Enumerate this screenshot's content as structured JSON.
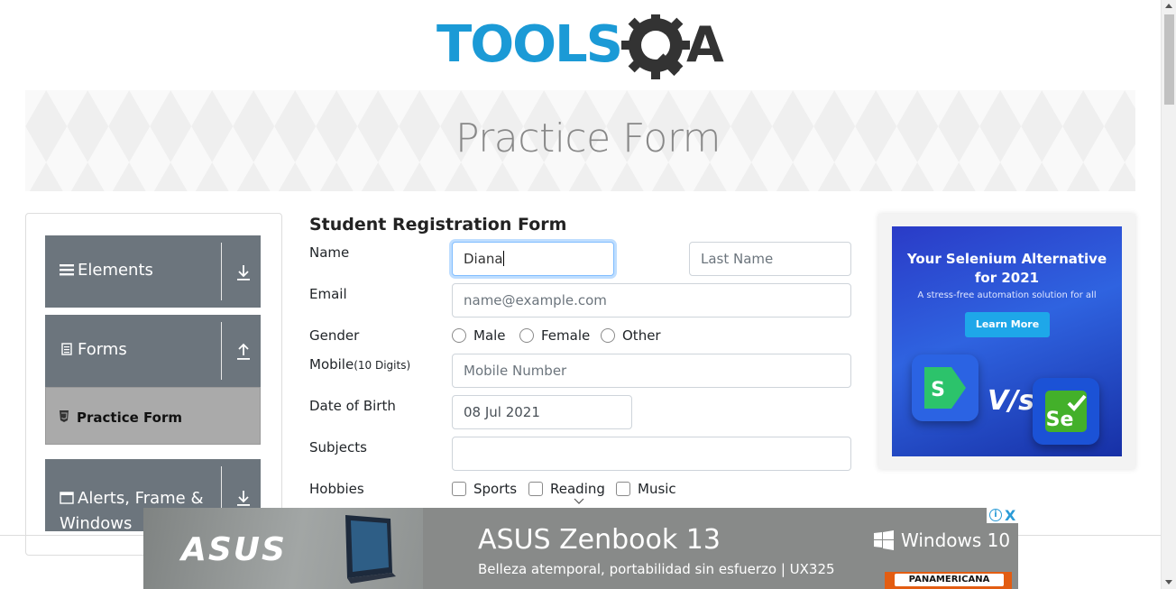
{
  "header": {
    "logo_text": "TOOLSQA",
    "page_title": "Practice Form"
  },
  "sidebar": {
    "groups": [
      {
        "label": "Elements",
        "arrow": "down"
      },
      {
        "label": "Forms",
        "arrow": "up"
      },
      {
        "label": "Alerts, Frame & Windows",
        "arrow": "down"
      }
    ],
    "active_item": "Practice Form"
  },
  "form": {
    "title": "Student Registration Form",
    "name_label": "Name",
    "first_name_value": "Diana",
    "last_name_placeholder": "Last Name",
    "email_label": "Email",
    "email_placeholder": "name@example.com",
    "gender_label": "Gender",
    "gender_options": [
      "Male",
      "Female",
      "Other"
    ],
    "mobile_label": "Mobile",
    "mobile_hint": "(10 Digits)",
    "mobile_placeholder": "Mobile Number",
    "dob_label": "Date of Birth",
    "dob_value": "08 Jul 2021",
    "subjects_label": "Subjects",
    "subjects_value": "",
    "hobbies_label": "Hobbies",
    "hobbies_options": [
      "Sports",
      "Reading",
      "Music"
    ]
  },
  "ad_right": {
    "headline_line1": "Your Selenium Alternative",
    "headline_line2": "for 2021",
    "sub": "A stress-free automation solution for all",
    "button": "Learn More",
    "vs": "V/s",
    "left_logo": "S",
    "right_logo": "Se"
  },
  "ad_bottom": {
    "brand": "ASUS",
    "title": "ASUS Zenbook 13",
    "subtitle": "Belleza atemporal, portabilidad sin esfuerzo  | UX325",
    "windows": "Windows 10",
    "retailer": "PANAMERICANA",
    "close": "X",
    "info": "i"
  },
  "colors": {
    "logo_blue": "#1b9ad6",
    "logo_dark": "#333333",
    "sidebar_header": "#6c757d",
    "sidebar_active": "#aaaaaa",
    "focus_border": "#80bdff"
  }
}
